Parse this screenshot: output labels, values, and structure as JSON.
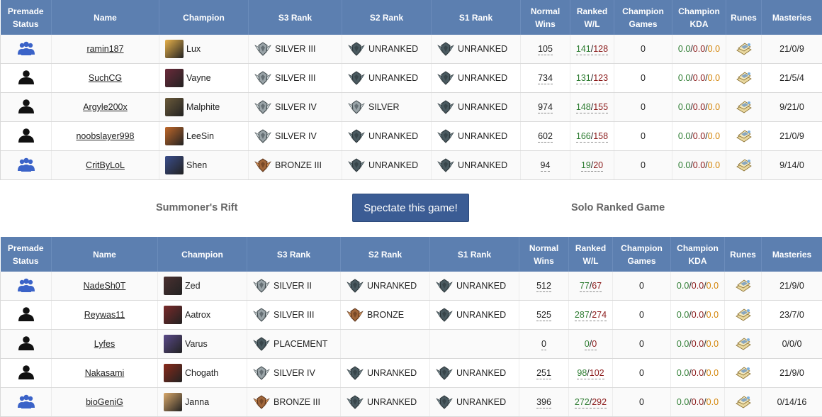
{
  "headers": {
    "premade": "Premade\nStatus",
    "name": "Name",
    "champion": "Champion",
    "s3": "S3 Rank",
    "s2": "S2 Rank",
    "s1": "S1 Rank",
    "normal": "Normal\nWins",
    "ranked": "Ranked\nW/L",
    "champ_games": "Champion\nGames",
    "champ_kda": "Champion\nKDA",
    "runes": "Runes",
    "masteries": "Masteries"
  },
  "middle": {
    "map": "Summoner's Rift",
    "spectate": "Spectate this game!",
    "queue": "Solo Ranked Game"
  },
  "colors": {
    "header_bg": "#5c7fb0",
    "premade_blue": "#3b63c8",
    "win": "#2e7d32",
    "loss": "#8b1a1a",
    "assist": "#d4860b",
    "button": "#3b5c94"
  },
  "team1": [
    {
      "premade": "group",
      "name": "ramin187",
      "champion": "Lux",
      "champ_color": "#e7b14a",
      "s3": "SILVER III",
      "s3_tier": "silver",
      "s2": "UNRANKED",
      "s2_tier": "unranked",
      "s1": "UNRANKED",
      "s1_tier": "unranked",
      "normal": "105",
      "w": "141",
      "l": "128",
      "games": "0",
      "k": "0.0",
      "d": "0.0",
      "a": "0.0",
      "masteries": "21/0/9"
    },
    {
      "premade": "solo",
      "name": "SuchCG",
      "champion": "Vayne",
      "champ_color": "#6b2a3a",
      "s3": "SILVER III",
      "s3_tier": "silver",
      "s2": "UNRANKED",
      "s2_tier": "unranked",
      "s1": "UNRANKED",
      "s1_tier": "unranked",
      "normal": "734",
      "w": "131",
      "l": "123",
      "games": "0",
      "k": "0.0",
      "d": "0.0",
      "a": "0.0",
      "masteries": "21/5/4"
    },
    {
      "premade": "solo",
      "name": "Argyle200x",
      "champion": "Malphite",
      "champ_color": "#6b5a3a",
      "s3": "SILVER IV",
      "s3_tier": "silver",
      "s2": "SILVER",
      "s2_tier": "silver",
      "s1": "UNRANKED",
      "s1_tier": "unranked",
      "normal": "974",
      "w": "148",
      "l": "155",
      "games": "0",
      "k": "0.0",
      "d": "0.0",
      "a": "0.0",
      "masteries": "9/21/0"
    },
    {
      "premade": "solo",
      "name": "noobslayer998",
      "champion": "LeeSin",
      "champ_color": "#c0682a",
      "s3": "SILVER IV",
      "s3_tier": "silver",
      "s2": "UNRANKED",
      "s2_tier": "unranked",
      "s1": "UNRANKED",
      "s1_tier": "unranked",
      "normal": "602",
      "w": "166",
      "l": "158",
      "games": "0",
      "k": "0.0",
      "d": "0.0",
      "a": "0.0",
      "masteries": "21/0/9"
    },
    {
      "premade": "group",
      "name": "CritByLoL",
      "champion": "Shen",
      "champ_color": "#3b4e8c",
      "s3": "BRONZE III",
      "s3_tier": "bronze",
      "s2": "UNRANKED",
      "s2_tier": "unranked",
      "s1": "UNRANKED",
      "s1_tier": "unranked",
      "normal": "94",
      "w": "19",
      "l": "20",
      "games": "0",
      "k": "0.0",
      "d": "0.0",
      "a": "0.0",
      "masteries": "9/14/0"
    }
  ],
  "team2": [
    {
      "premade": "group",
      "name": "NadeSh0T",
      "champion": "Zed",
      "champ_color": "#4a3030",
      "s3": "SILVER II",
      "s3_tier": "silver",
      "s2": "UNRANKED",
      "s2_tier": "unranked",
      "s1": "UNRANKED",
      "s1_tier": "unranked",
      "normal": "512",
      "w": "77",
      "l": "67",
      "games": "0",
      "k": "0.0",
      "d": "0.0",
      "a": "0.0",
      "masteries": "21/9/0"
    },
    {
      "premade": "solo",
      "name": "Reywas11",
      "champion": "Aatrox",
      "champ_color": "#7a2a2a",
      "s3": "SILVER III",
      "s3_tier": "silver",
      "s2": "BRONZE",
      "s2_tier": "bronze",
      "s1": "UNRANKED",
      "s1_tier": "unranked",
      "normal": "525",
      "w": "287",
      "l": "274",
      "games": "0",
      "k": "0.0",
      "d": "0.0",
      "a": "0.0",
      "masteries": "23/7/0"
    },
    {
      "premade": "solo",
      "name": "Lyfes",
      "champion": "Varus",
      "champ_color": "#5a4a8a",
      "s3": "PLACEMENT",
      "s3_tier": "unranked",
      "s2": "",
      "s2_tier": "",
      "s1": "",
      "s1_tier": "",
      "normal": "0",
      "w": "0",
      "l": "0",
      "games": "0",
      "k": "0.0",
      "d": "0.0",
      "a": "0.0",
      "masteries": "0/0/0"
    },
    {
      "premade": "solo",
      "name": "Nakasami",
      "champion": "Chogath",
      "champ_color": "#8a2a1a",
      "s3": "SILVER IV",
      "s3_tier": "silver",
      "s2": "UNRANKED",
      "s2_tier": "unranked",
      "s1": "UNRANKED",
      "s1_tier": "unranked",
      "normal": "251",
      "w": "98",
      "l": "102",
      "games": "0",
      "k": "0.0",
      "d": "0.0",
      "a": "0.0",
      "masteries": "21/9/0"
    },
    {
      "premade": "group",
      "name": "bioGeniG",
      "champion": "Janna",
      "champ_color": "#d9a86a",
      "s3": "BRONZE III",
      "s3_tier": "bronze",
      "s2": "UNRANKED",
      "s2_tier": "unranked",
      "s1": "UNRANKED",
      "s1_tier": "unranked",
      "normal": "396",
      "w": "272",
      "l": "292",
      "games": "0",
      "k": "0.0",
      "d": "0.0",
      "a": "0.0",
      "masteries": "0/14/16"
    }
  ]
}
